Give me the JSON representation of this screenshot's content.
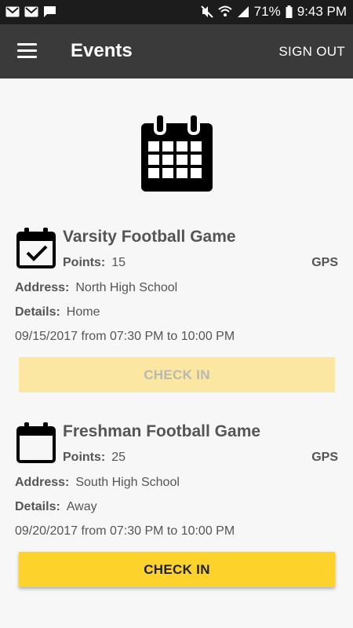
{
  "status_bar": {
    "battery": "71%",
    "time": "9:43 PM",
    "icons": [
      "gmail-icon",
      "gmail-icon",
      "chat-icon",
      "mute-icon",
      "wifi-icon",
      "signal-icon",
      "battery-icon"
    ]
  },
  "app_bar": {
    "title": "Events",
    "sign_out": "SIGN OUT"
  },
  "events": [
    {
      "title": "Varsity Football Game",
      "points_label": "Points:",
      "points": "15",
      "gps": "GPS",
      "address_label": "Address:",
      "address": "North High School",
      "details_label": "Details:",
      "details": "Home",
      "schedule": "09/15/2017 from 07:30 PM to 10:00 PM",
      "button": "CHECK IN",
      "checked_in": true,
      "icon": "calendar-check-icon"
    },
    {
      "title": "Freshman Football Game",
      "points_label": "Points:",
      "points": "25",
      "gps": "GPS",
      "address_label": "Address:",
      "address": "South High School",
      "details_label": "Details:",
      "details": "Away",
      "schedule": "09/20/2017 from 07:30 PM to 10:00 PM",
      "button": "CHECK IN",
      "checked_in": false,
      "icon": "calendar-icon"
    }
  ],
  "colors": {
    "status_bar": "#1c1c1c",
    "app_bar": "#3a3a3a",
    "accent": "#fdd22b",
    "accent_disabled": "#fbe7a1"
  }
}
